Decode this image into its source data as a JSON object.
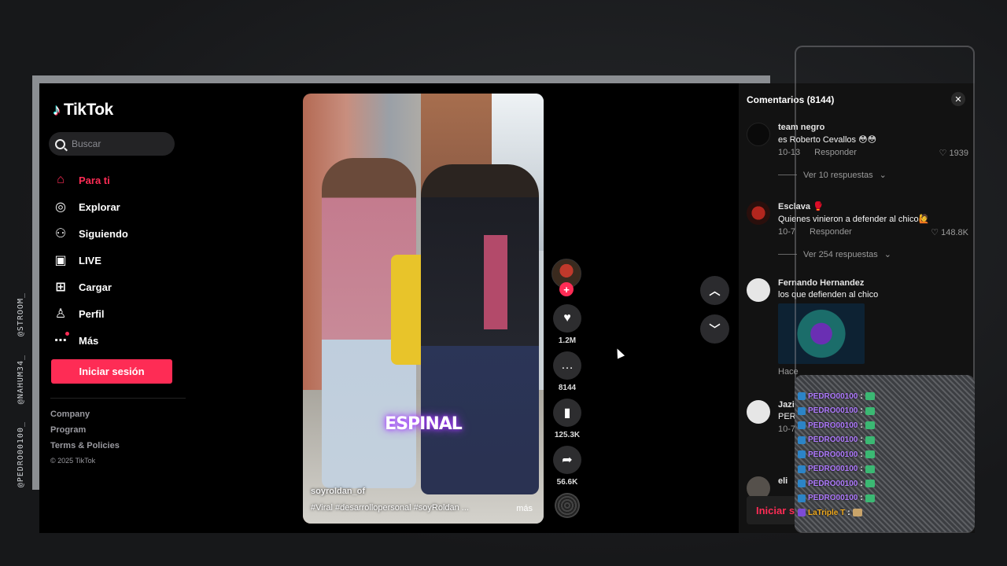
{
  "watermarks": [
    "@PEDRO00100_",
    "@NAHUM34_",
    "@STROOM_"
  ],
  "sidebar": {
    "logo_text": "TikTok",
    "search_placeholder": "Buscar",
    "nav_items": [
      {
        "label": "Para ti",
        "icon": "home-icon",
        "active": true
      },
      {
        "label": "Explorar",
        "icon": "compass-icon",
        "active": false
      },
      {
        "label": "Siguiendo",
        "icon": "user-follow-icon",
        "active": false
      },
      {
        "label": "LIVE",
        "icon": "live-tv-icon",
        "active": false
      },
      {
        "label": "Cargar",
        "icon": "upload-plus-icon",
        "active": false
      },
      {
        "label": "Perfil",
        "icon": "profile-icon",
        "active": false
      },
      {
        "label": "Más",
        "icon": "more-dots-icon",
        "active": false
      }
    ],
    "login_label": "Iniciar sesión",
    "footer_links": [
      "Company",
      "Program",
      "Terms & Policies"
    ],
    "copyright": "© 2025 TikTok"
  },
  "video": {
    "caption_word": "ESPINAL",
    "author": "soyroldan_of",
    "hashtags": "#Viral  #desarrollopersonal  #soyRoldan  ...",
    "more_label": "más"
  },
  "actions": {
    "likes": "1.2M",
    "comments": "8144",
    "saves": "125.3K",
    "shares": "56.6K"
  },
  "comments": {
    "header": "Comentarios (8144)",
    "items": [
      {
        "name": "team negro",
        "text": "es Roberto Cevallos 😳😳",
        "date": "10-13",
        "reply": "Responder",
        "likes": "1939",
        "replies": "Ver 10 respuestas"
      },
      {
        "name": "Esclava 🥊",
        "text": "Quienes vinieron a defender al chico🙋",
        "date": "10-7",
        "reply": "Responder",
        "likes": "148.8K",
        "replies": "Ver 254 respuestas"
      },
      {
        "name": "Fernando Hernandez",
        "text": "los que defienden al chico",
        "date": "Hace"
      },
      {
        "name": "Jazi",
        "text": "PER",
        "date": "10-7"
      },
      {
        "name": "eli",
        "text": ""
      }
    ],
    "login_label": "Iniciar se"
  },
  "chat": [
    {
      "user": "PEDRO00100",
      "alt": false
    },
    {
      "user": "PEDRO00100",
      "alt": false
    },
    {
      "user": "PEDRO00100",
      "alt": false
    },
    {
      "user": "PEDRO00100",
      "alt": false
    },
    {
      "user": "PEDRO00100",
      "alt": false
    },
    {
      "user": "PEDRO00100",
      "alt": false
    },
    {
      "user": "PEDRO00100",
      "alt": false
    },
    {
      "user": "PEDRO00100",
      "alt": false
    },
    {
      "user": "LaTriple T",
      "alt": true
    }
  ],
  "colors": {
    "accent": "#fe2c55",
    "background": "#000000",
    "panel": "#121212"
  }
}
